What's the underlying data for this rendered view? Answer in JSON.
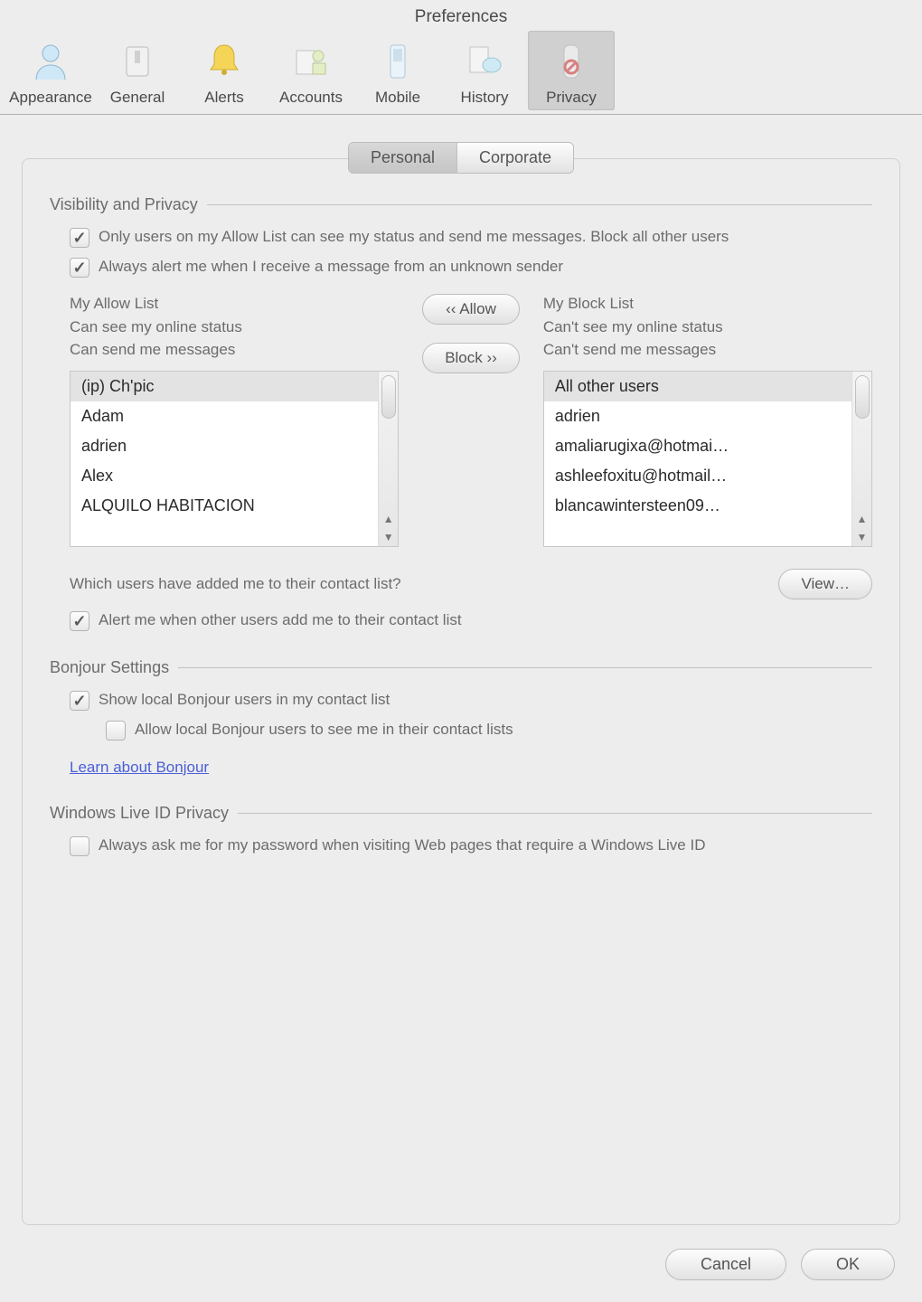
{
  "window": {
    "title": "Preferences"
  },
  "toolbar": {
    "items": [
      {
        "label": "Appearance"
      },
      {
        "label": "General"
      },
      {
        "label": "Alerts"
      },
      {
        "label": "Accounts"
      },
      {
        "label": "Mobile"
      },
      {
        "label": "History"
      },
      {
        "label": "Privacy"
      }
    ]
  },
  "segmented": {
    "personal": "Personal",
    "corporate": "Corporate"
  },
  "sections": {
    "visibility": {
      "title": "Visibility and Privacy",
      "only_allow_list": "Only users on my Allow List can see my status and send me messages. Block all other users",
      "always_alert_unknown": "Always alert me when I receive a message from an unknown sender",
      "allow_header1": "My Allow List",
      "allow_header2": "Can see my online status",
      "allow_header3": "Can send me messages",
      "block_header1": "My Block List",
      "block_header2": "Can't see my online status",
      "block_header3": "Can't send me messages",
      "allow_button": "‹‹ Allow",
      "block_button": "Block ››",
      "which_users": "Which users have added me to their contact list?",
      "view": "View…",
      "alert_added": "Alert me when other users add me to their contact list"
    },
    "bonjour": {
      "title": "Bonjour Settings",
      "show_local": "Show local Bonjour users in my contact list",
      "allow_local": "Allow local Bonjour users to see me in their contact lists",
      "learn": "Learn about Bonjour"
    },
    "wlid": {
      "title": "Windows Live ID Privacy",
      "always_ask": "Always ask me for my password when visiting Web pages that require a Windows Live ID"
    }
  },
  "allow_list": [
    "(ip) Ch'pic",
    "Adam",
    "adrien",
    "Alex",
    "ALQUILO HABITACION"
  ],
  "block_list": [
    "All other users",
    "adrien",
    "amaliarugixa@hotmai…",
    "ashleefoxitu@hotmail…",
    "blancawintersteen09…"
  ],
  "buttons": {
    "cancel": "Cancel",
    "ok": "OK"
  }
}
